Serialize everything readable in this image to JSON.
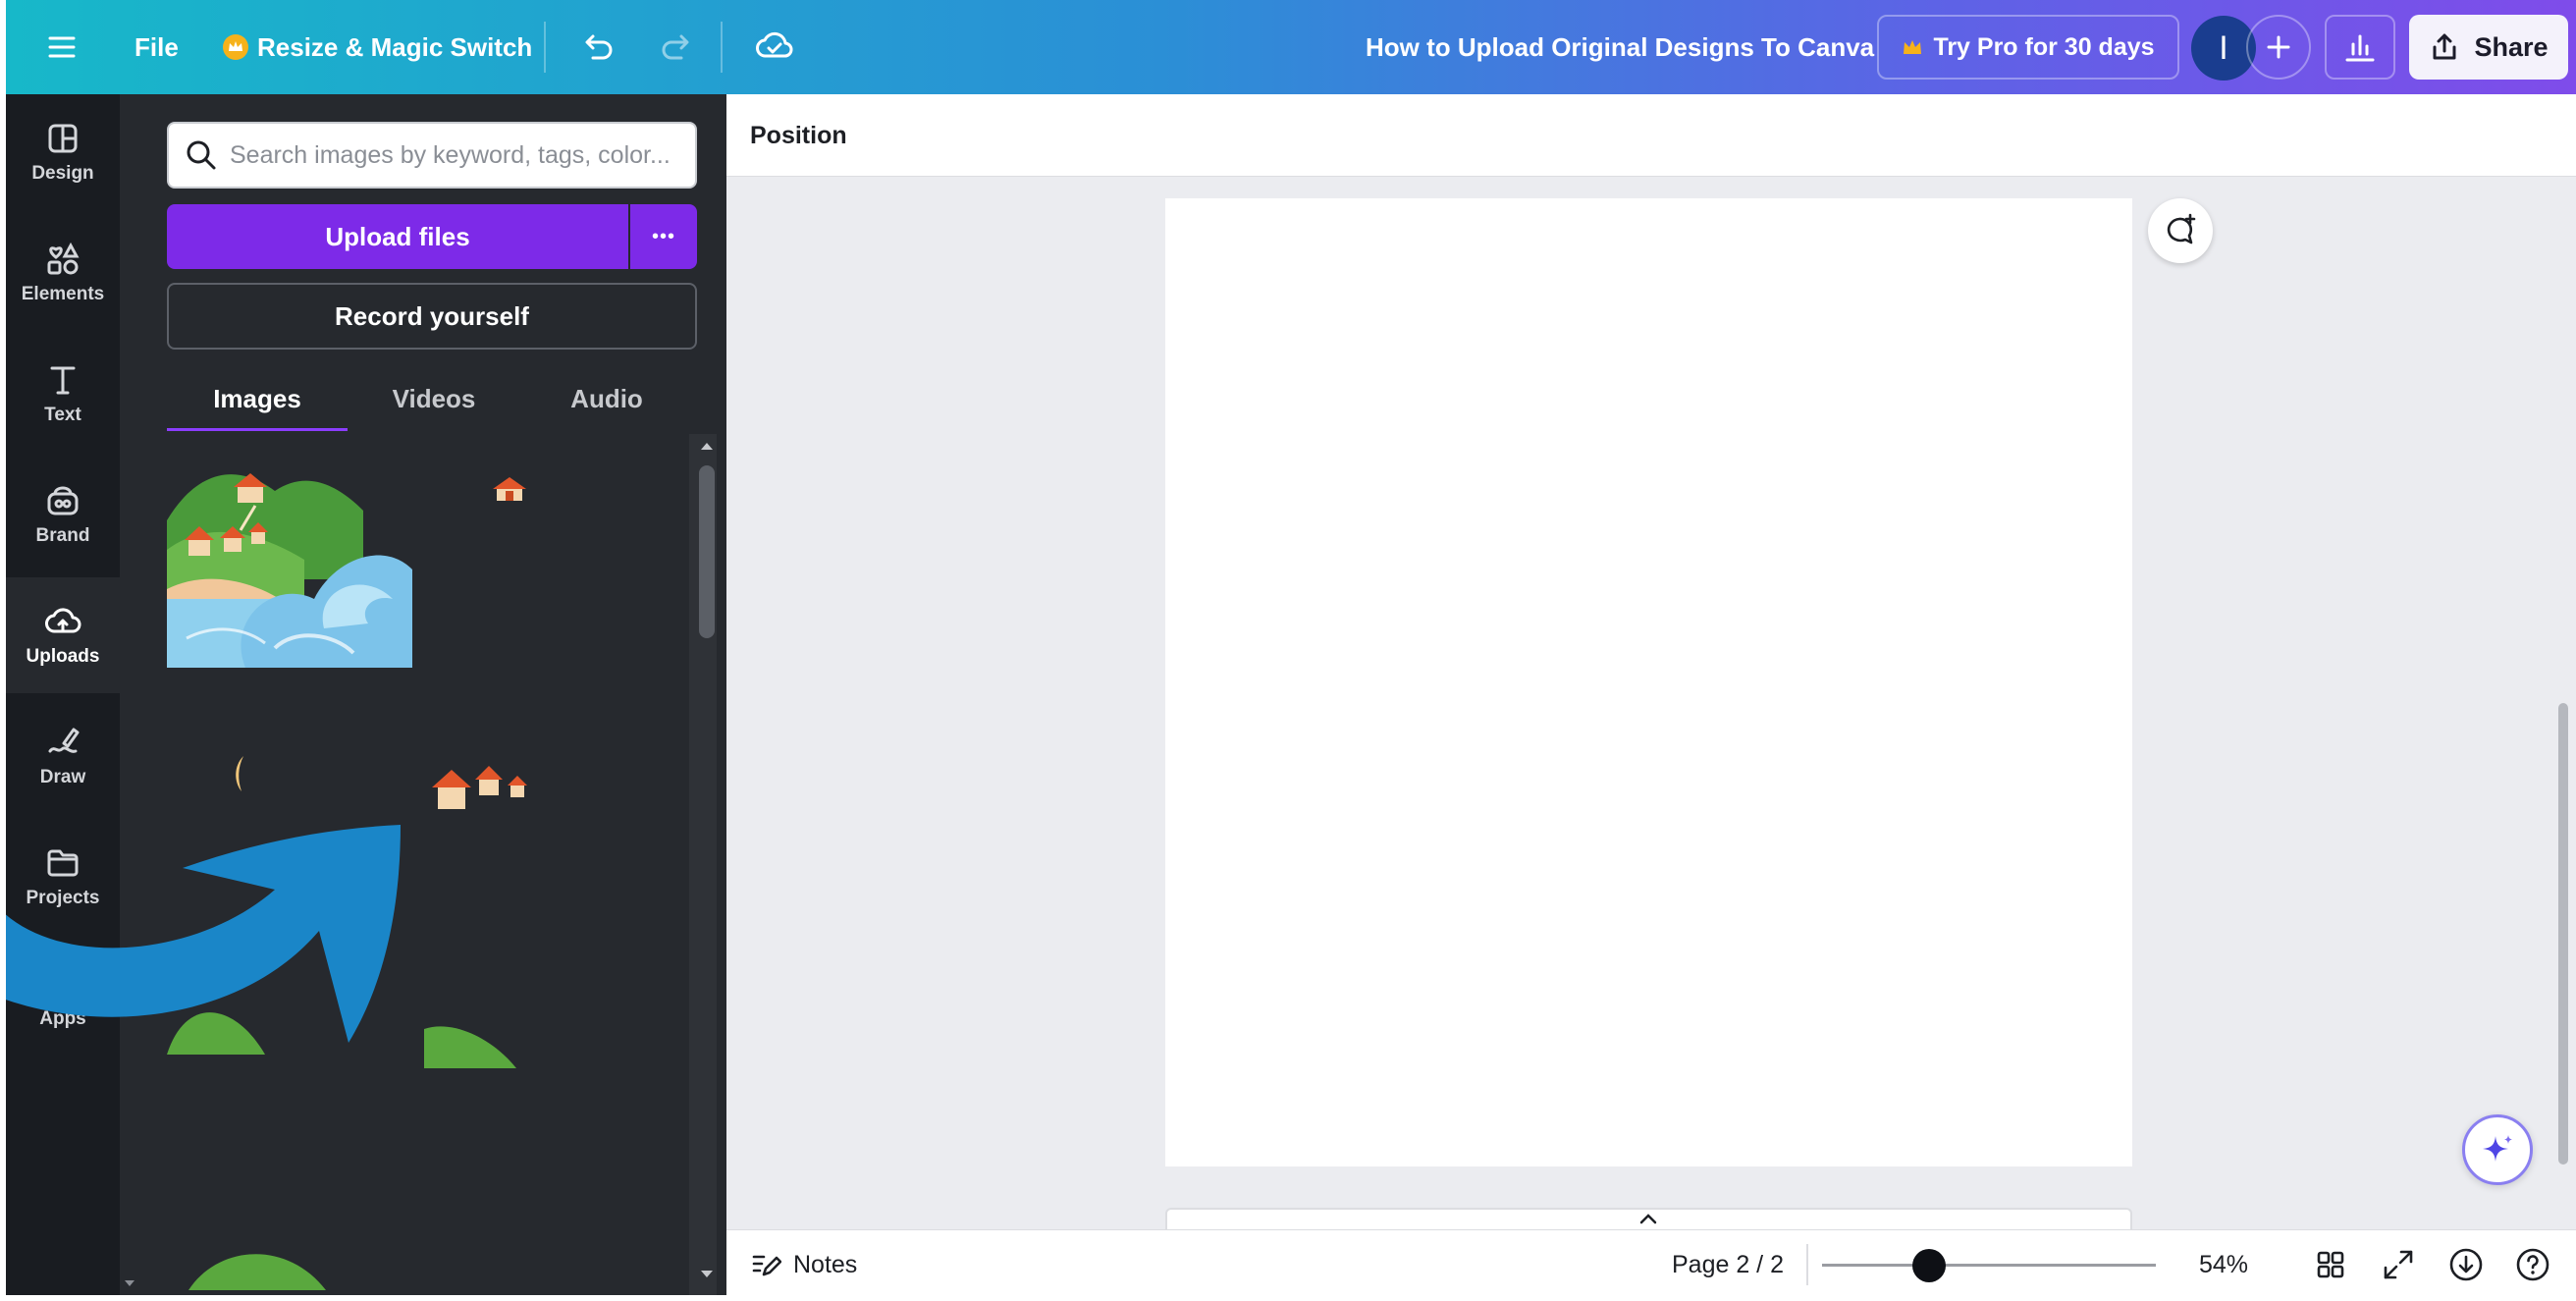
{
  "topbar": {
    "file_label": "File",
    "resize_label": "Resize & Magic Switch",
    "doc_title": "How to Upload Original Designs To Canva",
    "try_pro_label": "Try Pro for 30 days",
    "avatar_initial": "I",
    "share_label": "Share"
  },
  "rail": {
    "items": [
      {
        "label": "Design",
        "icon": "design-icon"
      },
      {
        "label": "Elements",
        "icon": "elements-icon"
      },
      {
        "label": "Text",
        "icon": "text-icon"
      },
      {
        "label": "Brand",
        "icon": "brand-icon"
      },
      {
        "label": "Uploads",
        "icon": "cloud-upload-icon"
      },
      {
        "label": "Draw",
        "icon": "draw-icon"
      },
      {
        "label": "Projects",
        "icon": "folder-icon"
      },
      {
        "label": "Apps",
        "icon": "apps-icon"
      }
    ],
    "active": "Uploads"
  },
  "panel": {
    "search_placeholder": "Search images by keyword, tags, color...",
    "upload_label": "Upload files",
    "more_label": "•••",
    "record_label": "Record yourself",
    "tabs": [
      "Images",
      "Videos",
      "Audio"
    ],
    "active_tab": "Images"
  },
  "workspace": {
    "context_label": "Position"
  },
  "bottombar": {
    "notes_label": "Notes",
    "page_indicator": "Page 2 / 2",
    "zoom_percent": "54%",
    "zoom_fraction": 0.32
  },
  "colors": {
    "accent_purple": "#7d2ae8",
    "rail_bg": "#191c21",
    "panel_bg": "#26292e",
    "workspace_bg": "#ebecf0",
    "arrow_blue": "#1a86c8"
  }
}
